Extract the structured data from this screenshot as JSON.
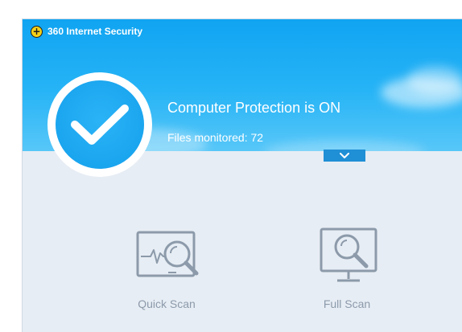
{
  "app": {
    "title": "360 Internet Security",
    "logo_glyph": "+"
  },
  "status": {
    "title": "Computer Protection is ON",
    "files_monitored": "Files monitored: 72",
    "icon": "checkmark-icon"
  },
  "expand": {
    "icon": "chevron-down-icon"
  },
  "scans": [
    {
      "label": "Quick Scan",
      "icon": "quick-scan-icon"
    },
    {
      "label": "Full Scan",
      "icon": "full-scan-icon"
    }
  ],
  "colors": {
    "header_blue": "#10a4f2",
    "expand_button": "#1f8fd6",
    "icon_gray": "#8c9aaa",
    "body_bg": "#e7edf4",
    "logo_yellow": "#f7d117"
  }
}
